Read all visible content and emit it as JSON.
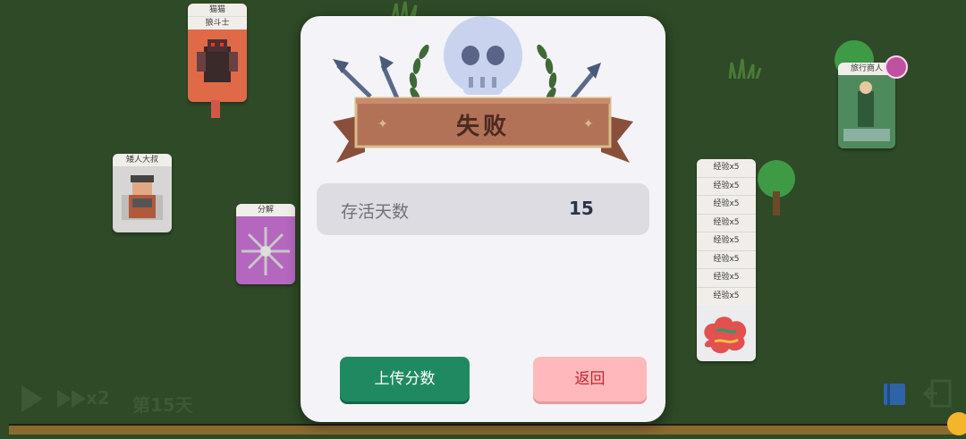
{
  "board": {
    "cards": [
      {
        "id": "cat",
        "title": "猫猫",
        "subtitle": "狼斗士"
      },
      {
        "id": "dwarf",
        "title": "矮人大叔"
      },
      {
        "id": "decompose",
        "title": "分解"
      },
      {
        "id": "merchant",
        "title": "旅行商人"
      }
    ],
    "exp_stack": {
      "label": "经验x5",
      "count": 8
    }
  },
  "modal": {
    "title": "失败",
    "stat_label": "存活天数",
    "stat_value": "15",
    "upload_button": "上传分数",
    "back_button": "返回"
  },
  "controls": {
    "speed_label": "x2",
    "day_label": "第15天"
  },
  "colors": {
    "upload": "#1f8a62",
    "back_bg": "#ffb8bc",
    "back_text": "#c0262e",
    "board": "#2e4a26"
  }
}
